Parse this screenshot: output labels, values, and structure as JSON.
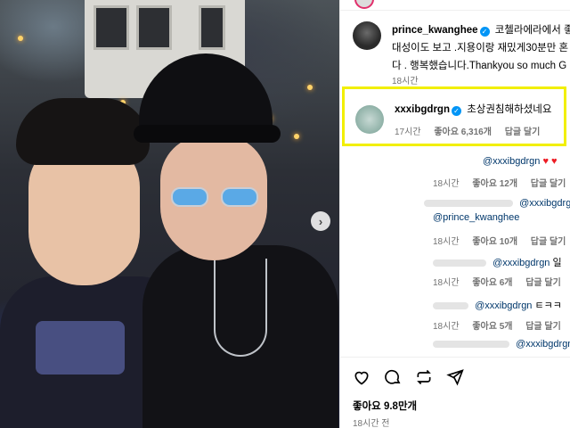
{
  "post": {
    "author": "prince_kwanghee",
    "caption_line1": "코첼라에라에서 좋",
    "caption_line2": "대성이도 보고 .지용이랑 재밌게30분만 혼",
    "caption_line3": "다 . 행복했습니다.Thankyou so much G",
    "caption_time": "18시간",
    "likes_label": "좋아요",
    "likes_count": "9.8만개",
    "time": "18시간 전"
  },
  "highlighted_comment": {
    "username": "xxxibgdrgn",
    "text": "초상권침해하셨네요",
    "time": "17시간",
    "likes": "좋아요 6,316개",
    "reply_label": "답글 달기"
  },
  "replies": [
    {
      "mention": "@xxxibgdrgn",
      "suffix": "",
      "time": "18시간",
      "likes": "좋아요 12개",
      "reply_label": "답글 달기"
    },
    {
      "mention": "@xxxibgdrgn",
      "mention2": "@prince_kwanghee",
      "time": "18시간",
      "likes": "좋아요 10개",
      "reply_label": "답글 달기"
    },
    {
      "mention": "@xxxibgdrgn",
      "suffix": "일",
      "time": "18시간",
      "likes": "좋아요 6개",
      "reply_label": "답글 달기"
    },
    {
      "mention": "@xxxibgdrgn",
      "suffix": "ㅌㅋㅋ",
      "time": "18시간",
      "likes": "좋아요 5개",
      "reply_label": "답글 달기"
    },
    {
      "mention": "@xxxibgdrgn"
    }
  ],
  "icons": {
    "verified": "✓",
    "next": "›",
    "heart": "heart-outline-icon",
    "comment": "comment-icon",
    "repost": "repost-icon",
    "share": "share-icon"
  },
  "colors": {
    "highlight": "#f2ef00",
    "mention": "#00376b",
    "verified": "#0095f6"
  }
}
